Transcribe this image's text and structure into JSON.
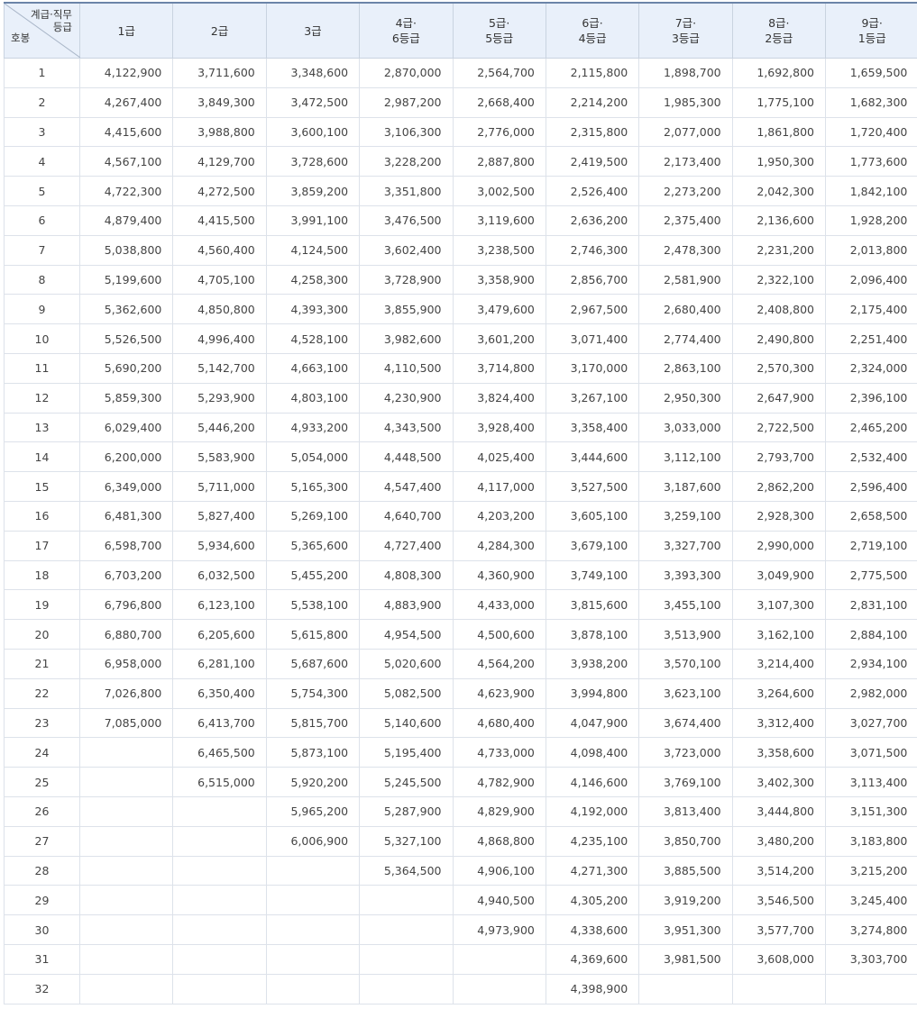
{
  "header": {
    "corner_top_line1": "계급·직무",
    "corner_top_line2": "등급",
    "corner_bottom": "호봉",
    "columns": [
      {
        "line1": "1급",
        "line2": ""
      },
      {
        "line1": "2급",
        "line2": ""
      },
      {
        "line1": "3급",
        "line2": ""
      },
      {
        "line1": "4급·",
        "line2": "6등급"
      },
      {
        "line1": "5급·",
        "line2": "5등급"
      },
      {
        "line1": "6급·",
        "line2": "4등급"
      },
      {
        "line1": "7급·",
        "line2": "3등급"
      },
      {
        "line1": "8급·",
        "line2": "2등급"
      },
      {
        "line1": "9급·",
        "line2": "1등급"
      }
    ]
  },
  "rows": [
    {
      "step": "1",
      "cells": [
        "4,122,900",
        "3,711,600",
        "3,348,600",
        "2,870,000",
        "2,564,700",
        "2,115,800",
        "1,898,700",
        "1,692,800",
        "1,659,500"
      ]
    },
    {
      "step": "2",
      "cells": [
        "4,267,400",
        "3,849,300",
        "3,472,500",
        "2,987,200",
        "2,668,400",
        "2,214,200",
        "1,985,300",
        "1,775,100",
        "1,682,300"
      ]
    },
    {
      "step": "3",
      "cells": [
        "4,415,600",
        "3,988,800",
        "3,600,100",
        "3,106,300",
        "2,776,000",
        "2,315,800",
        "2,077,000",
        "1,861,800",
        "1,720,400"
      ]
    },
    {
      "step": "4",
      "cells": [
        "4,567,100",
        "4,129,700",
        "3,728,600",
        "3,228,200",
        "2,887,800",
        "2,419,500",
        "2,173,400",
        "1,950,300",
        "1,773,600"
      ]
    },
    {
      "step": "5",
      "cells": [
        "4,722,300",
        "4,272,500",
        "3,859,200",
        "3,351,800",
        "3,002,500",
        "2,526,400",
        "2,273,200",
        "2,042,300",
        "1,842,100"
      ]
    },
    {
      "step": "6",
      "cells": [
        "4,879,400",
        "4,415,500",
        "3,991,100",
        "3,476,500",
        "3,119,600",
        "2,636,200",
        "2,375,400",
        "2,136,600",
        "1,928,200"
      ]
    },
    {
      "step": "7",
      "cells": [
        "5,038,800",
        "4,560,400",
        "4,124,500",
        "3,602,400",
        "3,238,500",
        "2,746,300",
        "2,478,300",
        "2,231,200",
        "2,013,800"
      ]
    },
    {
      "step": "8",
      "cells": [
        "5,199,600",
        "4,705,100",
        "4,258,300",
        "3,728,900",
        "3,358,900",
        "2,856,700",
        "2,581,900",
        "2,322,100",
        "2,096,400"
      ]
    },
    {
      "step": "9",
      "cells": [
        "5,362,600",
        "4,850,800",
        "4,393,300",
        "3,855,900",
        "3,479,600",
        "2,967,500",
        "2,680,400",
        "2,408,800",
        "2,175,400"
      ]
    },
    {
      "step": "10",
      "cells": [
        "5,526,500",
        "4,996,400",
        "4,528,100",
        "3,982,600",
        "3,601,200",
        "3,071,400",
        "2,774,400",
        "2,490,800",
        "2,251,400"
      ]
    },
    {
      "step": "11",
      "cells": [
        "5,690,200",
        "5,142,700",
        "4,663,100",
        "4,110,500",
        "3,714,800",
        "3,170,000",
        "2,863,100",
        "2,570,300",
        "2,324,000"
      ]
    },
    {
      "step": "12",
      "cells": [
        "5,859,300",
        "5,293,900",
        "4,803,100",
        "4,230,900",
        "3,824,400",
        "3,267,100",
        "2,950,300",
        "2,647,900",
        "2,396,100"
      ]
    },
    {
      "step": "13",
      "cells": [
        "6,029,400",
        "5,446,200",
        "4,933,200",
        "4,343,500",
        "3,928,400",
        "3,358,400",
        "3,033,000",
        "2,722,500",
        "2,465,200"
      ]
    },
    {
      "step": "14",
      "cells": [
        "6,200,000",
        "5,583,900",
        "5,054,000",
        "4,448,500",
        "4,025,400",
        "3,444,600",
        "3,112,100",
        "2,793,700",
        "2,532,400"
      ]
    },
    {
      "step": "15",
      "cells": [
        "6,349,000",
        "5,711,000",
        "5,165,300",
        "4,547,400",
        "4,117,000",
        "3,527,500",
        "3,187,600",
        "2,862,200",
        "2,596,400"
      ]
    },
    {
      "step": "16",
      "cells": [
        "6,481,300",
        "5,827,400",
        "5,269,100",
        "4,640,700",
        "4,203,200",
        "3,605,100",
        "3,259,100",
        "2,928,300",
        "2,658,500"
      ]
    },
    {
      "step": "17",
      "cells": [
        "6,598,700",
        "5,934,600",
        "5,365,600",
        "4,727,400",
        "4,284,300",
        "3,679,100",
        "3,327,700",
        "2,990,000",
        "2,719,100"
      ]
    },
    {
      "step": "18",
      "cells": [
        "6,703,200",
        "6,032,500",
        "5,455,200",
        "4,808,300",
        "4,360,900",
        "3,749,100",
        "3,393,300",
        "3,049,900",
        "2,775,500"
      ]
    },
    {
      "step": "19",
      "cells": [
        "6,796,800",
        "6,123,100",
        "5,538,100",
        "4,883,900",
        "4,433,000",
        "3,815,600",
        "3,455,100",
        "3,107,300",
        "2,831,100"
      ]
    },
    {
      "step": "20",
      "cells": [
        "6,880,700",
        "6,205,600",
        "5,615,800",
        "4,954,500",
        "4,500,600",
        "3,878,100",
        "3,513,900",
        "3,162,100",
        "2,884,100"
      ]
    },
    {
      "step": "21",
      "cells": [
        "6,958,000",
        "6,281,100",
        "5,687,600",
        "5,020,600",
        "4,564,200",
        "3,938,200",
        "3,570,100",
        "3,214,400",
        "2,934,100"
      ]
    },
    {
      "step": "22",
      "cells": [
        "7,026,800",
        "6,350,400",
        "5,754,300",
        "5,082,500",
        "4,623,900",
        "3,994,800",
        "3,623,100",
        "3,264,600",
        "2,982,000"
      ]
    },
    {
      "step": "23",
      "cells": [
        "7,085,000",
        "6,413,700",
        "5,815,700",
        "5,140,600",
        "4,680,400",
        "4,047,900",
        "3,674,400",
        "3,312,400",
        "3,027,700"
      ]
    },
    {
      "step": "24",
      "cells": [
        "",
        "6,465,500",
        "5,873,100",
        "5,195,400",
        "4,733,000",
        "4,098,400",
        "3,723,000",
        "3,358,600",
        "3,071,500"
      ]
    },
    {
      "step": "25",
      "cells": [
        "",
        "6,515,000",
        "5,920,200",
        "5,245,500",
        "4,782,900",
        "4,146,600",
        "3,769,100",
        "3,402,300",
        "3,113,400"
      ]
    },
    {
      "step": "26",
      "cells": [
        "",
        "",
        "5,965,200",
        "5,287,900",
        "4,829,900",
        "4,192,000",
        "3,813,400",
        "3,444,800",
        "3,151,300"
      ]
    },
    {
      "step": "27",
      "cells": [
        "",
        "",
        "6,006,900",
        "5,327,100",
        "4,868,800",
        "4,235,100",
        "3,850,700",
        "3,480,200",
        "3,183,800"
      ]
    },
    {
      "step": "28",
      "cells": [
        "",
        "",
        "",
        "5,364,500",
        "4,906,100",
        "4,271,300",
        "3,885,500",
        "3,514,200",
        "3,215,200"
      ]
    },
    {
      "step": "29",
      "cells": [
        "",
        "",
        "",
        "",
        "4,940,500",
        "4,305,200",
        "3,919,200",
        "3,546,500",
        "3,245,400"
      ]
    },
    {
      "step": "30",
      "cells": [
        "",
        "",
        "",
        "",
        "4,973,900",
        "4,338,600",
        "3,951,300",
        "3,577,700",
        "3,274,800"
      ]
    },
    {
      "step": "31",
      "cells": [
        "",
        "",
        "",
        "",
        "",
        "4,369,600",
        "3,981,500",
        "3,608,000",
        "3,303,700"
      ]
    },
    {
      "step": "32",
      "cells": [
        "",
        "",
        "",
        "",
        "",
        "4,398,900",
        "",
        "",
        ""
      ]
    }
  ]
}
